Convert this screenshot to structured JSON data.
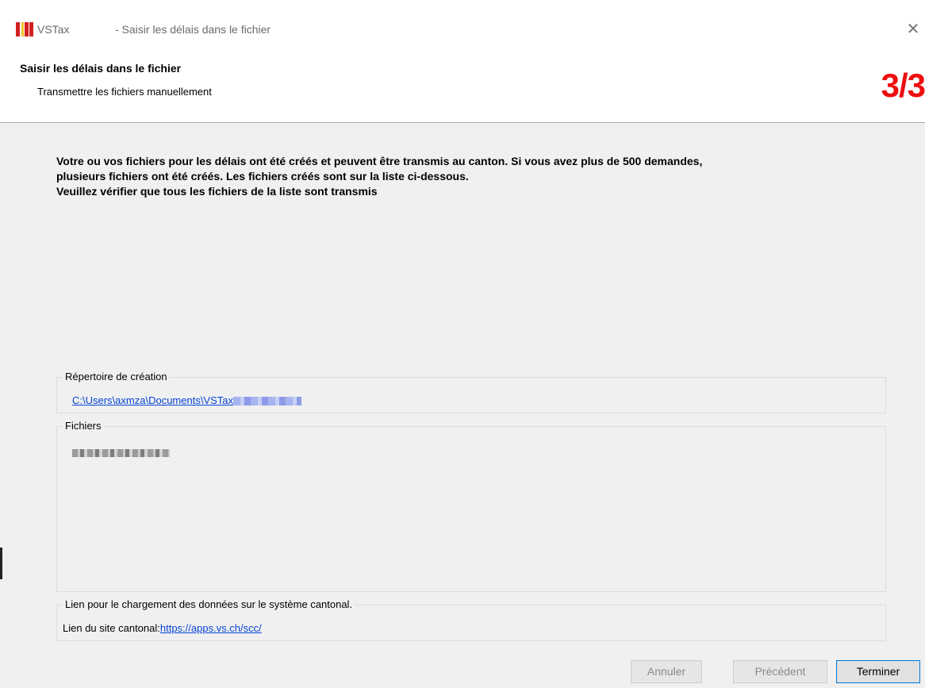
{
  "window": {
    "app_name": "VSTax",
    "title": "- Saisir les délais dans le fichier",
    "close_glyph": "✕"
  },
  "header": {
    "title": "Saisir les délais dans le fichier",
    "subtitle": "Transmettre les fichiers manuellement",
    "step": "3/3",
    "step_color": "#ee0f0f"
  },
  "message": {
    "line1": "Votre ou vos fichiers pour les délais ont été créés et peuvent être transmis au canton. Si vous avez plus de 500 demandes,",
    "line2": "plusieurs fichiers ont été créés. Les fichiers créés sont sur la liste ci-dessous.",
    "line3": "Veuillez vérifier que tous les fichiers de la liste sont transmis"
  },
  "creation_dir": {
    "legend": "Répertoire de création",
    "path": "C:\\Users\\axmza\\Documents\\VSTax"
  },
  "files": {
    "legend": "Fichiers"
  },
  "upload": {
    "legend": "Lien pour le chargement des données sur le système cantonal.",
    "label": "Lien du site cantonal:",
    "url": "https://apps.vs.ch/scc/"
  },
  "buttons": {
    "cancel": "Annuler",
    "previous": "Précédent",
    "finish": "Terminer"
  },
  "icons": {
    "app": "vstax-logo-icon",
    "close": "close-icon"
  }
}
